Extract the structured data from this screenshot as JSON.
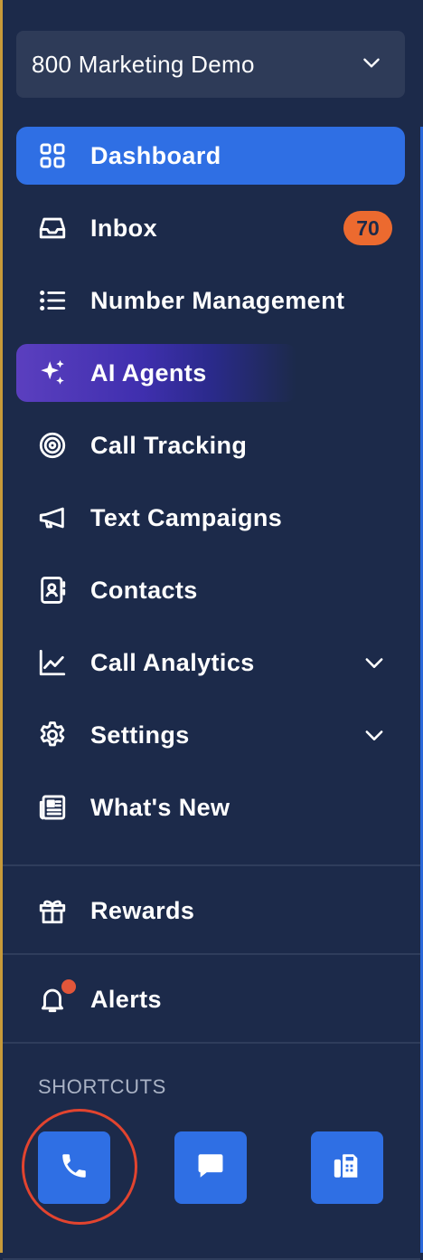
{
  "workspace": {
    "name": "800 Marketing Demo"
  },
  "nav": {
    "dashboard": "Dashboard",
    "inbox": "Inbox",
    "inbox_badge": "70",
    "number_management": "Number Management",
    "ai_agents": "AI Agents",
    "call_tracking": "Call Tracking",
    "text_campaigns": "Text Campaigns",
    "contacts": "Contacts",
    "call_analytics": "Call Analytics",
    "settings": "Settings",
    "whats_new": "What's New",
    "rewards": "Rewards",
    "alerts": "Alerts"
  },
  "shortcuts": {
    "label": "SHORTCUTS"
  },
  "icons": {
    "dashboard": "grid-icon",
    "inbox": "inbox-tray-icon",
    "number_management": "list-icon",
    "ai_agents": "sparkles-icon",
    "call_tracking": "target-icon",
    "text_campaigns": "megaphone-icon",
    "contacts": "contact-card-icon",
    "call_analytics": "line-chart-icon",
    "settings": "gear-icon",
    "whats_new": "newspaper-icon",
    "rewards": "gift-icon",
    "alerts": "bell-icon",
    "shortcut_call": "phone-icon",
    "shortcut_message": "chat-bubble-icon",
    "shortcut_fax": "fax-icon"
  },
  "colors": {
    "background": "#1c2a4a",
    "accent": "#2f6fe4",
    "badge": "#ec6a2f",
    "alert_dot": "#e2563a",
    "ai_gradient_start": "#5b3fbf",
    "highlight_ring": "#e2442f"
  }
}
